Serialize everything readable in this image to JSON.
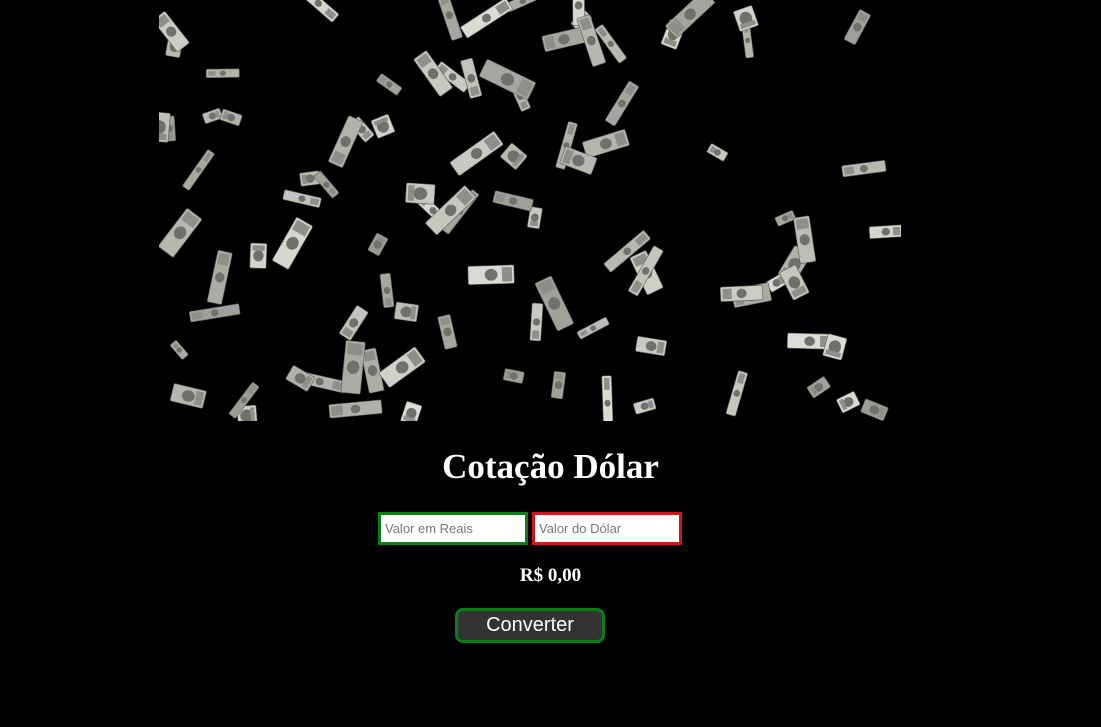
{
  "hero": {
    "image": "falling-money-bills-image",
    "background": "#000000"
  },
  "page": {
    "title": "Cotação Dólar"
  },
  "form": {
    "reais_placeholder": "Valor em Reais",
    "dolar_placeholder": "Valor do Dólar",
    "reais_value": "",
    "dolar_value": "",
    "reais_border_color": "#0b7d1a",
    "dolar_border_color": "#d01616"
  },
  "result": {
    "text": "R$ 0,00"
  },
  "actions": {
    "convert_label": "Converter",
    "button_border_color": "#0b7d1a",
    "button_background": "#333333"
  }
}
